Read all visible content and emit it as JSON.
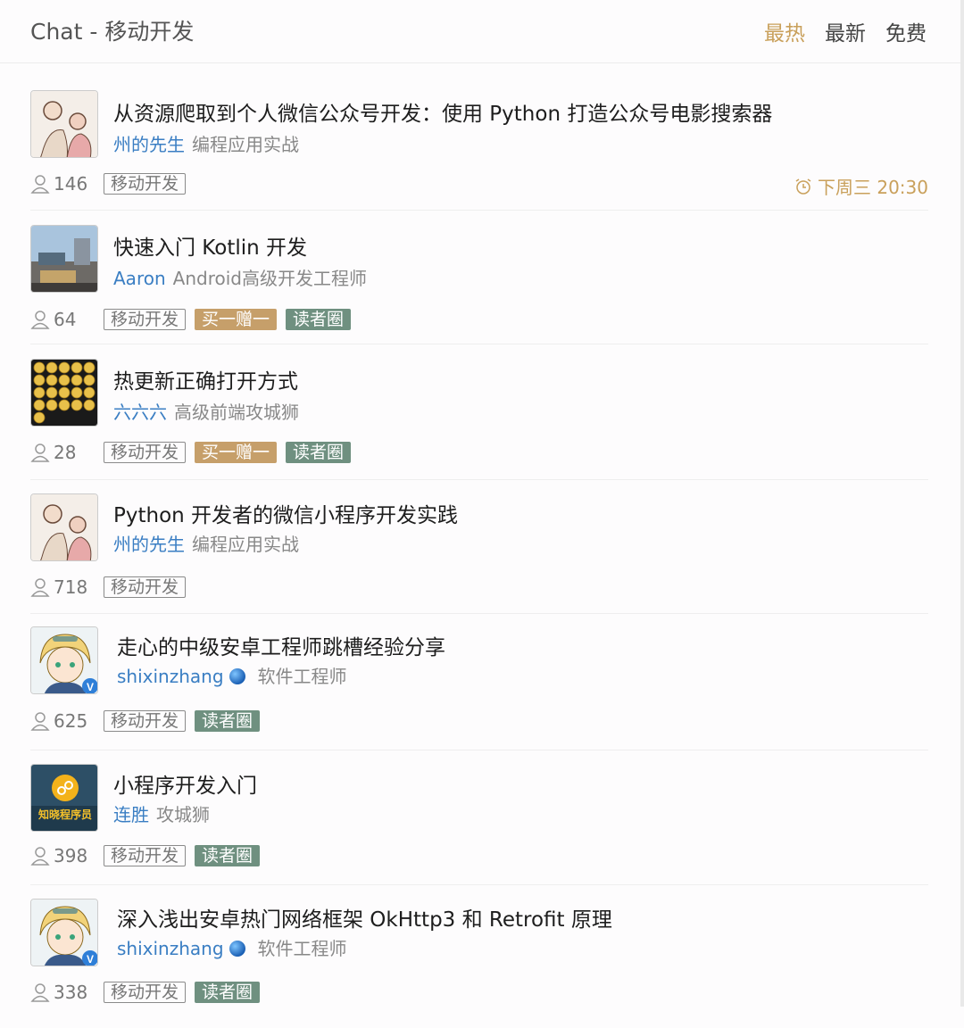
{
  "header": {
    "title": "Chat - 移动开发",
    "tabs": [
      {
        "label": "最热",
        "active": true
      },
      {
        "label": "最新",
        "active": false
      },
      {
        "label": "免费",
        "active": false
      }
    ]
  },
  "items": [
    {
      "title": "从资源爬取到个人微信公众号开发：使用 Python 打造公众号电影搜索器",
      "author": "州的先生",
      "role": "编程应用实战",
      "count": "146",
      "tags": [
        "移动开发"
      ],
      "time": "下周三 20:30",
      "avatar": "illustration-avatar"
    },
    {
      "title": "快速入门 Kotlin 开发",
      "author": "Aaron",
      "role": "Android高级开发工程师",
      "count": "64",
      "tags": [
        "移动开发",
        "买一赠一",
        "读者圈"
      ],
      "avatar": "city-photo-avatar"
    },
    {
      "title": "热更新正确打开方式",
      "author": "六六六",
      "role": "高级前端攻城狮",
      "count": "28",
      "tags": [
        "移动开发",
        "买一赠一",
        "读者圈"
      ],
      "avatar": "gold-coins-avatar"
    },
    {
      "title": "Python 开发者的微信小程序开发实践",
      "author": "州的先生",
      "role": "编程应用实战",
      "count": "718",
      "tags": [
        "移动开发"
      ],
      "avatar": "illustration-avatar"
    },
    {
      "title": "走心的中级安卓工程师跳槽经验分享",
      "author": "shixinzhang",
      "role": "软件工程师",
      "count": "625",
      "tags": [
        "移动开发",
        "读者圈"
      ],
      "avatar": "anime-avatar"
    },
    {
      "title": "小程序开发入门",
      "author": "连胜",
      "role": "攻城狮",
      "count": "398",
      "tags": [
        "移动开发",
        "读者圈"
      ],
      "avatar": "miniprogram-avatar",
      "avatar_text": "知晓程序员"
    },
    {
      "title": "深入浅出安卓热门网络框架 OkHttp3 和 Retrofit 原理",
      "author": "shixinzhang",
      "role": "软件工程师",
      "count": "338",
      "tags": [
        "移动开发",
        "读者圈"
      ],
      "avatar": "anime-avatar"
    }
  ]
}
